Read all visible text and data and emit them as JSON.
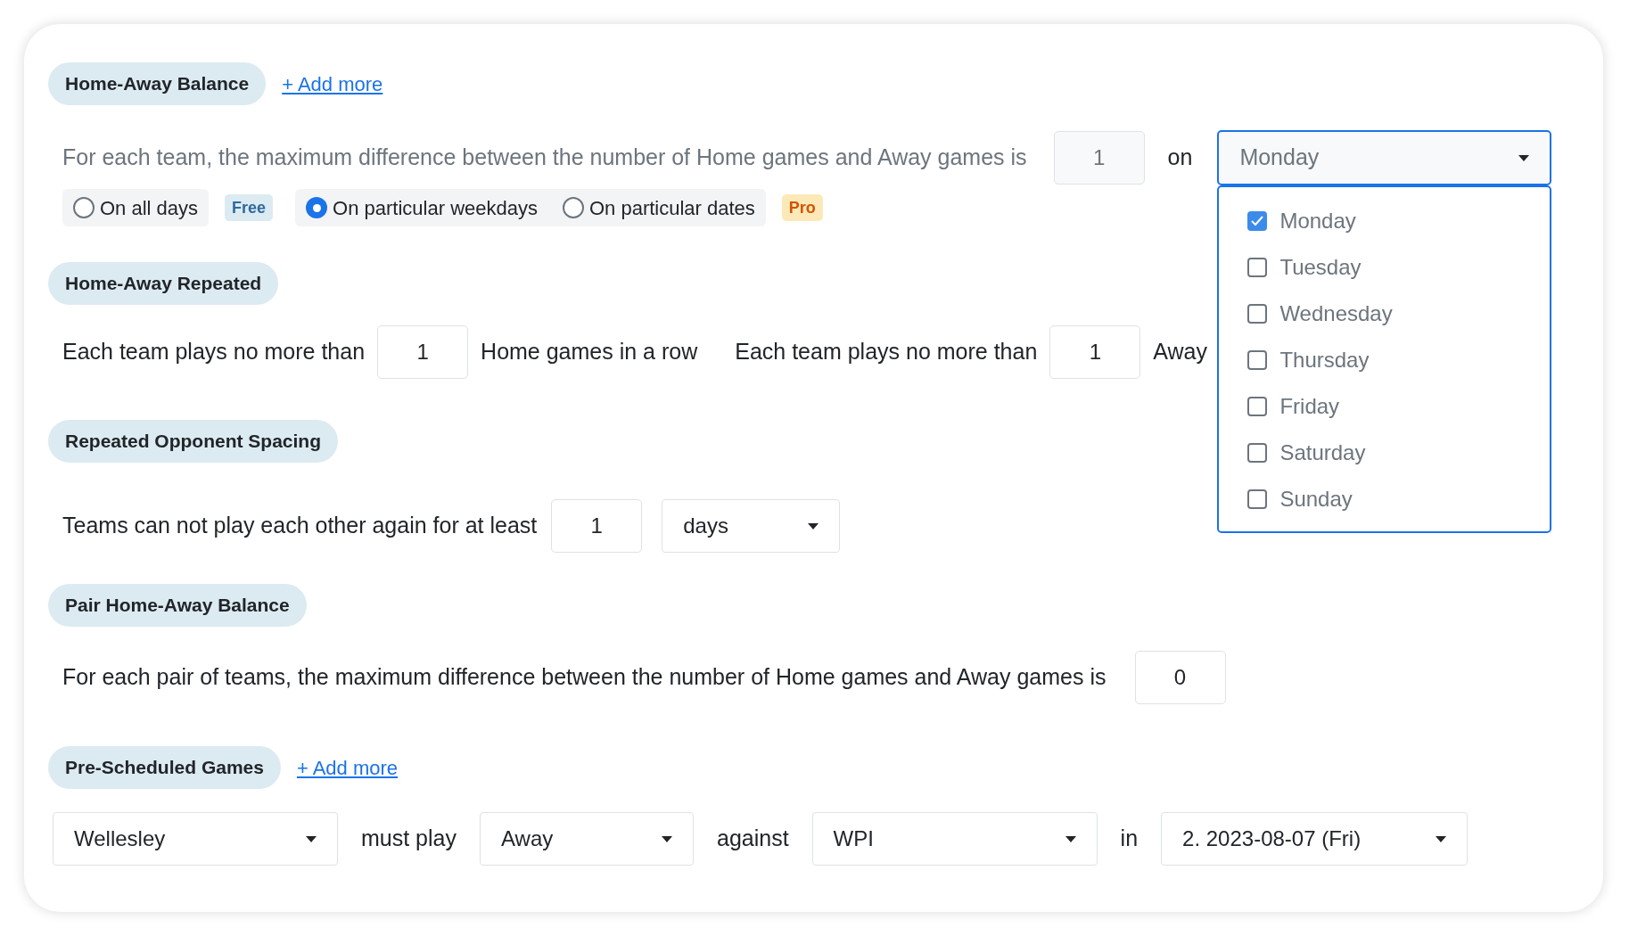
{
  "home_away_balance": {
    "title": "Home-Away Balance",
    "add_more": "+ Add more",
    "sentence": "For each team, the maximum difference between the number of Home games and Away games is",
    "value": "1",
    "on_label": "on",
    "weekday_select": {
      "value": "Monday",
      "expanded": true,
      "options": [
        {
          "label": "Monday",
          "checked": true
        },
        {
          "label": "Tuesday",
          "checked": false
        },
        {
          "label": "Wednesday",
          "checked": false
        },
        {
          "label": "Thursday",
          "checked": false
        },
        {
          "label": "Friday",
          "checked": false
        },
        {
          "label": "Saturday",
          "checked": false
        },
        {
          "label": "Sunday",
          "checked": false
        }
      ]
    },
    "mode_groups": [
      {
        "options": [
          {
            "label": "On all days",
            "selected": false
          }
        ],
        "badge": {
          "text": "Free",
          "kind": "free"
        }
      },
      {
        "options": [
          {
            "label": "On particular weekdays",
            "selected": true
          },
          {
            "label": "On particular dates",
            "selected": false
          }
        ],
        "badge": {
          "text": "Pro",
          "kind": "pro"
        }
      }
    ]
  },
  "home_away_repeated": {
    "title": "Home-Away Repeated",
    "home_prefix": "Each team plays no more than",
    "home_value": "1",
    "home_suffix": "Home games in a row",
    "away_prefix": "Each team plays no more than",
    "away_value": "1",
    "away_suffix": "Away"
  },
  "repeated_opponent_spacing": {
    "title": "Repeated Opponent Spacing",
    "sentence": "Teams can not play each other again for at least",
    "value": "1",
    "unit_select": "days"
  },
  "pair_home_away_balance": {
    "title": "Pair Home-Away Balance",
    "sentence": "For each pair of teams, the maximum difference between the number of Home games and Away games is",
    "value": "0"
  },
  "pre_scheduled_games": {
    "title": "Pre-Scheduled Games",
    "add_more": "+ Add more",
    "team_select": "Wellesley",
    "must_play": "must play",
    "venue_select": "Away",
    "against": "against",
    "opponent_select": "WPI",
    "in_label": "in",
    "date_select": "2. 2023-08-07 (Fri)"
  }
}
